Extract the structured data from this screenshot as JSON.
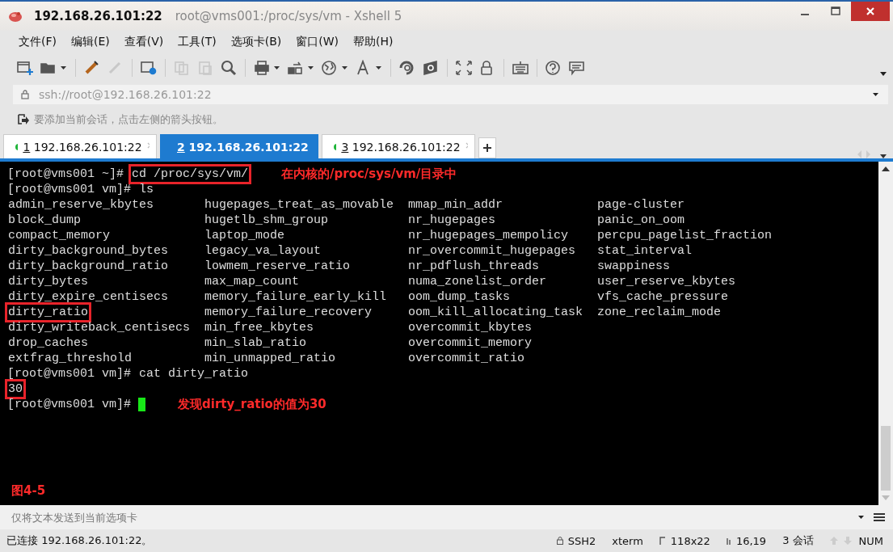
{
  "window": {
    "host": "192.168.26.101:22",
    "title": "root@vms001:/proc/sys/vm - Xshell 5"
  },
  "menu": [
    "文件(F)",
    "编辑(E)",
    "查看(V)",
    "工具(T)",
    "选项卡(B)",
    "窗口(W)",
    "帮助(H)"
  ],
  "toolbar": [
    {
      "kind": "new",
      "disabled": false
    },
    {
      "kind": "open",
      "disabled": false
    },
    {
      "kind": "sep"
    },
    {
      "kind": "connect",
      "disabled": false
    },
    {
      "kind": "disconnect",
      "disabled": true
    },
    {
      "kind": "sep"
    },
    {
      "kind": "properties",
      "disabled": false
    },
    {
      "kind": "sep"
    },
    {
      "kind": "copy",
      "disabled": true
    },
    {
      "kind": "paste",
      "disabled": true
    },
    {
      "kind": "find",
      "disabled": false
    },
    {
      "kind": "sep"
    },
    {
      "kind": "print",
      "disabled": false
    },
    {
      "kind": "transfer",
      "disabled": false
    },
    {
      "kind": "globe",
      "disabled": false
    },
    {
      "kind": "font",
      "disabled": false
    },
    {
      "kind": "sep"
    },
    {
      "kind": "xftp",
      "disabled": false
    },
    {
      "kind": "xftp2",
      "disabled": false
    },
    {
      "kind": "sep"
    },
    {
      "kind": "fullscreen",
      "disabled": false
    },
    {
      "kind": "lock",
      "disabled": false
    },
    {
      "kind": "sep"
    },
    {
      "kind": "keyboard",
      "disabled": false
    },
    {
      "kind": "sep"
    },
    {
      "kind": "help",
      "disabled": false
    },
    {
      "kind": "chat",
      "disabled": false
    }
  ],
  "address": {
    "value": "ssh://root@192.168.26.101:22"
  },
  "hint": "要添加当前会话，点击左侧的箭头按钮。",
  "tabs": [
    {
      "number": "1",
      "label": "192.168.26.101:22",
      "selected": false
    },
    {
      "number": "2",
      "label": "192.168.26.101:22",
      "selected": true
    },
    {
      "number": "3",
      "label": "192.168.26.101:22",
      "selected": false
    }
  ],
  "terminal": {
    "blocks": [
      {
        "kind": "prompt",
        "prompt": "[root@vms001 ~]#",
        "command": "cd /proc/sys/vm/",
        "highlighted": true,
        "note": "在内核的/proc/sys/vm/目录中"
      },
      {
        "kind": "prompt",
        "prompt": "[root@vms001 vm]#",
        "command": "ls",
        "highlighted": false
      },
      {
        "kind": "listing",
        "rows": [
          [
            {
              "text": "admin_reserve_kbytes",
              "highlighted": false
            },
            {
              "text": "hugepages_treat_as_movable",
              "highlighted": false
            },
            {
              "text": "mmap_min_addr",
              "highlighted": false
            },
            {
              "text": "page-cluster",
              "highlighted": false
            }
          ],
          [
            {
              "text": "block_dump",
              "highlighted": false
            },
            {
              "text": "hugetlb_shm_group",
              "highlighted": false
            },
            {
              "text": "nr_hugepages",
              "highlighted": false
            },
            {
              "text": "panic_on_oom",
              "highlighted": false
            }
          ],
          [
            {
              "text": "compact_memory",
              "highlighted": false
            },
            {
              "text": "laptop_mode",
              "highlighted": false
            },
            {
              "text": "nr_hugepages_mempolicy",
              "highlighted": false
            },
            {
              "text": "percpu_pagelist_fraction",
              "highlighted": false
            }
          ],
          [
            {
              "text": "dirty_background_bytes",
              "highlighted": false
            },
            {
              "text": "legacy_va_layout",
              "highlighted": false
            },
            {
              "text": "nr_overcommit_hugepages",
              "highlighted": false
            },
            {
              "text": "stat_interval",
              "highlighted": false
            }
          ],
          [
            {
              "text": "dirty_background_ratio",
              "highlighted": false
            },
            {
              "text": "lowmem_reserve_ratio",
              "highlighted": false
            },
            {
              "text": "nr_pdflush_threads",
              "highlighted": false
            },
            {
              "text": "swappiness",
              "highlighted": false
            }
          ],
          [
            {
              "text": "dirty_bytes",
              "highlighted": false
            },
            {
              "text": "max_map_count",
              "highlighted": false
            },
            {
              "text": "numa_zonelist_order",
              "highlighted": false
            },
            {
              "text": "user_reserve_kbytes",
              "highlighted": false
            }
          ],
          [
            {
              "text": "dirty_expire_centisecs",
              "highlighted": false
            },
            {
              "text": "memory_failure_early_kill",
              "highlighted": false
            },
            {
              "text": "oom_dump_tasks",
              "highlighted": false
            },
            {
              "text": "vfs_cache_pressure",
              "highlighted": false
            }
          ],
          [
            {
              "text": "dirty_ratio",
              "highlighted": true
            },
            {
              "text": "memory_failure_recovery",
              "highlighted": false
            },
            {
              "text": "oom_kill_allocating_task",
              "highlighted": false
            },
            {
              "text": "zone_reclaim_mode",
              "highlighted": false
            }
          ],
          [
            {
              "text": "dirty_writeback_centisecs",
              "highlighted": false
            },
            {
              "text": "min_free_kbytes",
              "highlighted": false
            },
            {
              "text": "overcommit_kbytes",
              "highlighted": false
            }
          ],
          [
            {
              "text": "drop_caches",
              "highlighted": false
            },
            {
              "text": "min_slab_ratio",
              "highlighted": false
            },
            {
              "text": "overcommit_memory",
              "highlighted": false
            }
          ],
          [
            {
              "text": "extfrag_threshold",
              "highlighted": false
            },
            {
              "text": "min_unmapped_ratio",
              "highlighted": false
            },
            {
              "text": "overcommit_ratio",
              "highlighted": false
            }
          ]
        ]
      },
      {
        "kind": "prompt",
        "prompt": "[root@vms001 vm]#",
        "command": "cat dirty_ratio",
        "highlighted": false
      },
      {
        "kind": "output",
        "text": "30",
        "highlighted": true
      },
      {
        "kind": "prompt",
        "prompt": "[root@vms001 vm]#",
        "cursor": true,
        "note": "发现dirty_ratio的值为30"
      }
    ],
    "figure_label": "图4-5"
  },
  "send_bar": {
    "placeholder": "仅将文本发送到当前选项卡"
  },
  "status_bar": {
    "connection": "已连接 192.168.26.101:22。",
    "protocol": "SSH2",
    "terminal": "xterm",
    "size": "118x22",
    "cursor": "16,19",
    "sessions": "3 会话",
    "num": "NUM"
  }
}
